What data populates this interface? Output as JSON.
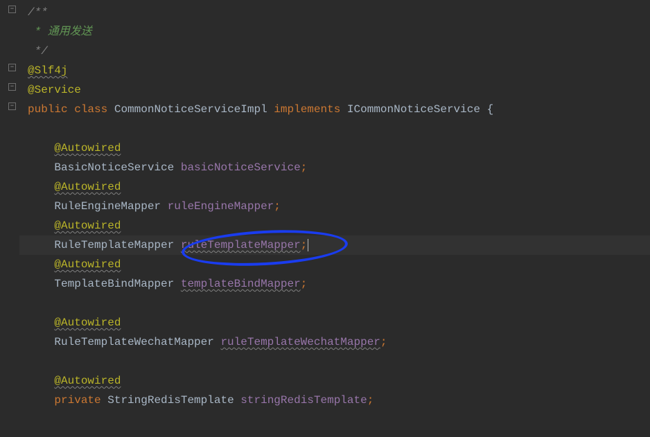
{
  "code": {
    "comment_open": "/**",
    "comment_body": " * 通用发送",
    "comment_close": " */",
    "slf4j": "@Slf4j",
    "service": "@Service",
    "public": "public",
    "class": "class",
    "class_name": "CommonNoticeServiceImpl",
    "implements": "implements",
    "interface_name": "ICommonNoticeService",
    "open_brace": "{",
    "autowired": "@Autowired",
    "basic_notice_type": "BasicNoticeService",
    "basic_notice_field": "basicNoticeService",
    "rule_engine_type": "RuleEngineMapper",
    "rule_engine_field": "ruleEngineMapper",
    "rule_template_type": "RuleTemplateMapper",
    "rule_template_field": "ruleTemplateMapper",
    "template_bind_type": "TemplateBindMapper",
    "template_bind_field": "templateBindMapper",
    "rule_template_wechat_type": "RuleTemplateWechatMapper",
    "rule_template_wechat_field": "ruleTemplateWechatMapper",
    "private": "private",
    "string_redis_type": "StringRedisTemplate",
    "string_redis_field": "stringRedisTemplate",
    "semi": ";"
  }
}
